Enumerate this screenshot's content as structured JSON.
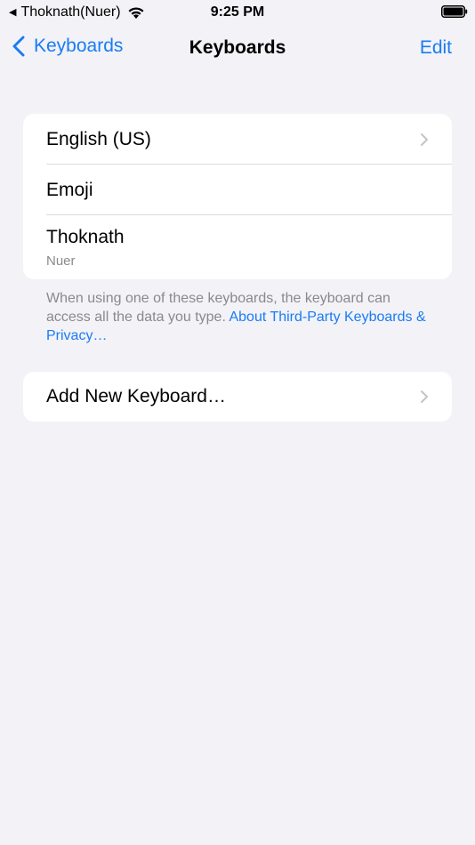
{
  "status_bar": {
    "back_app": "Thoknath(Nuer)",
    "time": "9:25 PM"
  },
  "nav": {
    "back_label": "Keyboards",
    "title": "Keyboards",
    "edit_label": "Edit"
  },
  "keyboards": [
    {
      "label": "English (US)",
      "sublabel": ""
    },
    {
      "label": "Emoji",
      "sublabel": ""
    },
    {
      "label": "Thoknath",
      "sublabel": "Nuer"
    }
  ],
  "footer": {
    "text": "When using one of these keyboards, the keyboard can access all the data you type. ",
    "link": "About Third-Party Keyboards & Privacy…"
  },
  "add_keyboard": {
    "label": "Add New Keyboard…"
  },
  "colors": {
    "accent": "#1a7cf3",
    "background": "#f2f2f7",
    "secondary_text": "#8a8a8e"
  }
}
